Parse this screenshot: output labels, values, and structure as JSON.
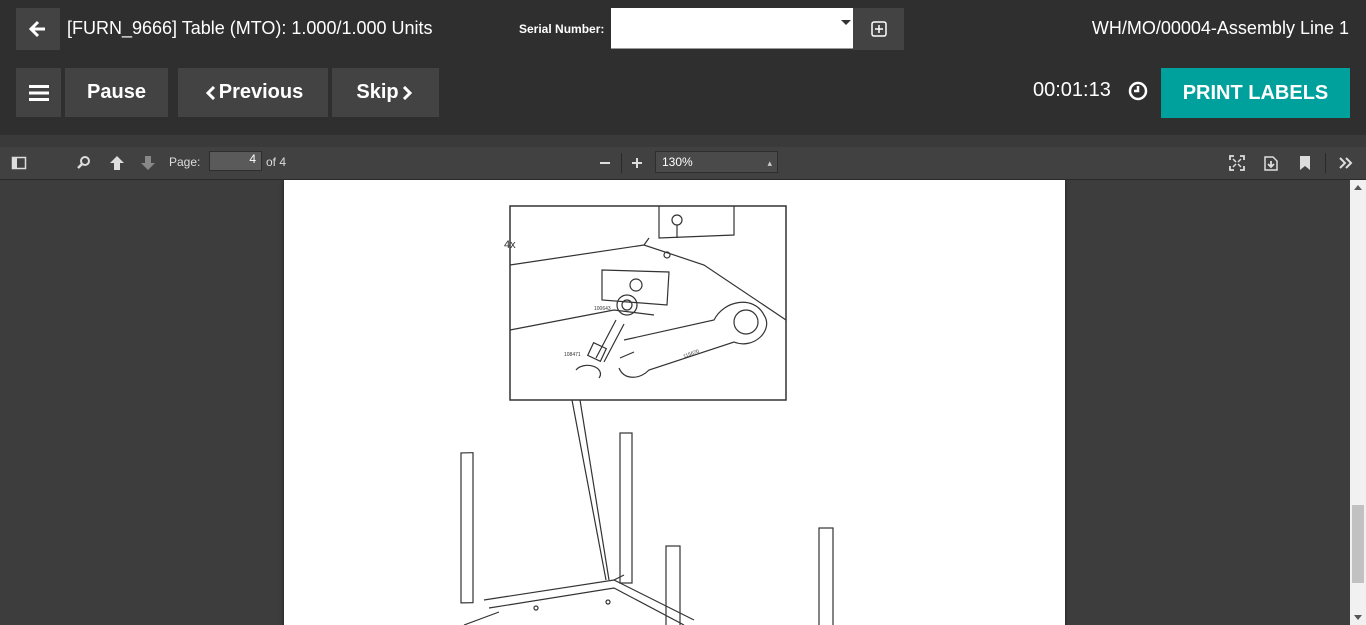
{
  "header": {
    "title": "[FURN_9666] Table (MTO): 1.000/1.000 Units",
    "serial_label": "Serial Number:",
    "serial_value": "",
    "workorder": "WH/MO/00004-Assembly Line 1"
  },
  "actions": {
    "pause": "Pause",
    "previous": "Previous",
    "skip": "Skip",
    "timer": "00:01:13",
    "print_labels": "PRINT LABELS"
  },
  "pdf": {
    "page_label": "Page:",
    "page_current": "4",
    "page_total_label": "of 4",
    "zoom": "130%"
  },
  "drawing": {
    "count_label": "4x",
    "part_a": "100643",
    "part_b": "108471",
    "part_c": "115670"
  },
  "colors": {
    "accent": "#00a09d",
    "topbar": "#2f2f2f",
    "button": "#434343"
  }
}
